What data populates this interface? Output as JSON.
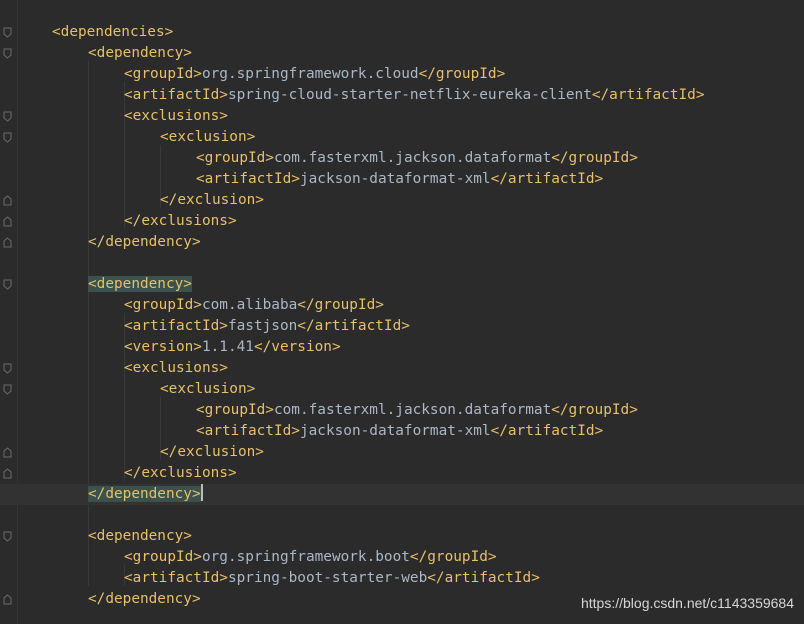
{
  "editor": {
    "language": "xml",
    "current_line": 23,
    "highlighted_tag_lines": [
      13,
      23
    ],
    "lines": [
      {
        "indent": 1,
        "parts": [
          {
            "t": "<dependencies>",
            "k": "tag"
          }
        ]
      },
      {
        "indent": 2,
        "parts": [
          {
            "t": "<dependency>",
            "k": "tag"
          }
        ]
      },
      {
        "indent": 3,
        "parts": [
          {
            "t": "<groupId>",
            "k": "tag"
          },
          {
            "t": "org.springframework.cloud",
            "k": "txt"
          },
          {
            "t": "</groupId>",
            "k": "tag"
          }
        ]
      },
      {
        "indent": 3,
        "parts": [
          {
            "t": "<artifactId>",
            "k": "tag"
          },
          {
            "t": "spring-cloud-starter-netflix-eureka-client",
            "k": "txt"
          },
          {
            "t": "</artifactId>",
            "k": "tag"
          }
        ]
      },
      {
        "indent": 3,
        "parts": [
          {
            "t": "<exclusions>",
            "k": "tag"
          }
        ]
      },
      {
        "indent": 4,
        "parts": [
          {
            "t": "<exclusion>",
            "k": "tag"
          }
        ]
      },
      {
        "indent": 5,
        "parts": [
          {
            "t": "<groupId>",
            "k": "tag"
          },
          {
            "t": "com.fasterxml.jackson.dataformat",
            "k": "txt"
          },
          {
            "t": "</groupId>",
            "k": "tag"
          }
        ]
      },
      {
        "indent": 5,
        "parts": [
          {
            "t": "<artifactId>",
            "k": "tag"
          },
          {
            "t": "jackson-dataformat-xml",
            "k": "txt"
          },
          {
            "t": "</artifactId>",
            "k": "tag"
          }
        ]
      },
      {
        "indent": 4,
        "parts": [
          {
            "t": "</exclusion>",
            "k": "tag"
          }
        ]
      },
      {
        "indent": 3,
        "parts": [
          {
            "t": "</exclusions>",
            "k": "tag"
          }
        ]
      },
      {
        "indent": 2,
        "parts": [
          {
            "t": "</dependency>",
            "k": "tag"
          }
        ]
      },
      {
        "indent": 0,
        "parts": []
      },
      {
        "indent": 2,
        "parts": [
          {
            "t": "<dependency>",
            "k": "tag",
            "hl": true
          }
        ]
      },
      {
        "indent": 3,
        "parts": [
          {
            "t": "<groupId>",
            "k": "tag"
          },
          {
            "t": "com.alibaba",
            "k": "txt"
          },
          {
            "t": "</groupId>",
            "k": "tag"
          }
        ]
      },
      {
        "indent": 3,
        "parts": [
          {
            "t": "<artifactId>",
            "k": "tag"
          },
          {
            "t": "fastjson",
            "k": "txt"
          },
          {
            "t": "</artifactId>",
            "k": "tag"
          }
        ]
      },
      {
        "indent": 3,
        "parts": [
          {
            "t": "<version>",
            "k": "tag"
          },
          {
            "t": "1.1.41",
            "k": "txt"
          },
          {
            "t": "</version>",
            "k": "tag"
          }
        ]
      },
      {
        "indent": 3,
        "parts": [
          {
            "t": "<exclusions>",
            "k": "tag"
          }
        ]
      },
      {
        "indent": 4,
        "parts": [
          {
            "t": "<exclusion>",
            "k": "tag"
          }
        ]
      },
      {
        "indent": 5,
        "parts": [
          {
            "t": "<groupId>",
            "k": "tag"
          },
          {
            "t": "com.fasterxml.jackson.dataformat",
            "k": "txt"
          },
          {
            "t": "</groupId>",
            "k": "tag"
          }
        ]
      },
      {
        "indent": 5,
        "parts": [
          {
            "t": "<artifactId>",
            "k": "tag"
          },
          {
            "t": "jackson-dataformat-xml",
            "k": "txt"
          },
          {
            "t": "</artifactId>",
            "k": "tag"
          }
        ]
      },
      {
        "indent": 4,
        "parts": [
          {
            "t": "</exclusion>",
            "k": "tag"
          }
        ]
      },
      {
        "indent": 3,
        "parts": [
          {
            "t": "</exclusions>",
            "k": "tag"
          }
        ]
      },
      {
        "indent": 2,
        "parts": [
          {
            "t": "</dependency>",
            "k": "tag",
            "hl": true
          }
        ],
        "caret": true
      },
      {
        "indent": 0,
        "parts": []
      },
      {
        "indent": 2,
        "parts": [
          {
            "t": "<dependency>",
            "k": "tag"
          }
        ]
      },
      {
        "indent": 3,
        "parts": [
          {
            "t": "<groupId>",
            "k": "tag"
          },
          {
            "t": "org.springframework.boot",
            "k": "txt"
          },
          {
            "t": "</groupId>",
            "k": "tag"
          }
        ]
      },
      {
        "indent": 3,
        "parts": [
          {
            "t": "<artifactId>",
            "k": "tag"
          },
          {
            "t": "spring-boot-starter-web",
            "k": "txt"
          },
          {
            "t": "</artifactId>",
            "k": "tag"
          }
        ]
      },
      {
        "indent": 2,
        "parts": [
          {
            "t": "</dependency>",
            "k": "tag"
          }
        ]
      }
    ],
    "fold_markers": [
      {
        "line": 1,
        "kind": "open"
      },
      {
        "line": 2,
        "kind": "open"
      },
      {
        "line": 5,
        "kind": "open"
      },
      {
        "line": 6,
        "kind": "open"
      },
      {
        "line": 9,
        "kind": "close"
      },
      {
        "line": 10,
        "kind": "close"
      },
      {
        "line": 11,
        "kind": "close"
      },
      {
        "line": 13,
        "kind": "open"
      },
      {
        "line": 17,
        "kind": "open"
      },
      {
        "line": 18,
        "kind": "open"
      },
      {
        "line": 21,
        "kind": "close"
      },
      {
        "line": 22,
        "kind": "close"
      },
      {
        "line": 23,
        "kind": "close"
      },
      {
        "line": 25,
        "kind": "open"
      },
      {
        "line": 28,
        "kind": "close"
      }
    ]
  },
  "watermark": {
    "text": "https://blog.csdn.net/c1143359684"
  },
  "colors": {
    "background": "#2b2b2b",
    "tag": "#e8bf6a",
    "text": "#a9b7c6",
    "current_line": "#323232",
    "tag_match_highlight": "#3b514d"
  }
}
